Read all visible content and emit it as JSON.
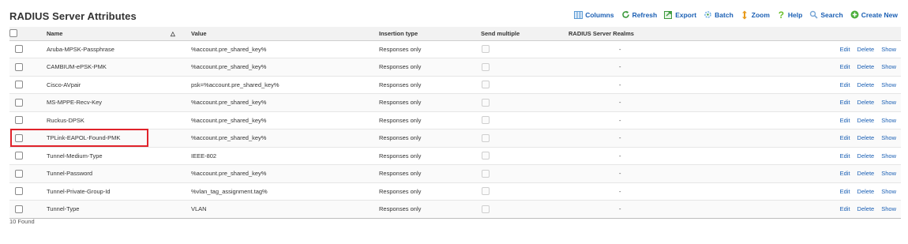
{
  "page": {
    "title": "RADIUS Server Attributes",
    "found_label": "10 Found"
  },
  "toolbar": {
    "items": [
      {
        "label": "Columns",
        "icon": "columns-icon",
        "color": "#5b9bd5"
      },
      {
        "label": "Refresh",
        "icon": "refresh-icon",
        "color": "#3c9a3c"
      },
      {
        "label": "Export",
        "icon": "export-icon",
        "color": "#3c9a3c"
      },
      {
        "label": "Batch",
        "icon": "batch-icon",
        "color": "#6fb0e8"
      },
      {
        "label": "Zoom",
        "icon": "zoom-icon",
        "color": "#e89a1a"
      },
      {
        "label": "Help",
        "icon": "help-icon",
        "color": "#6abf2a"
      },
      {
        "label": "Search",
        "icon": "search-icon",
        "color": "#7aa7d6"
      },
      {
        "label": "Create New",
        "icon": "create-new-icon",
        "color": "#4caf3c"
      }
    ]
  },
  "table": {
    "headers": {
      "name": "Name",
      "sort": "△",
      "value": "Value",
      "insertion_type": "Insertion type",
      "send_multiple": "Send multiple",
      "realms": "RADIUS Server Realms"
    },
    "actions": {
      "edit": "Edit",
      "delete": "Delete",
      "show": "Show"
    },
    "rows": [
      {
        "name": "Aruba-MPSK-Passphrase",
        "value": "%account.pre_shared_key%",
        "insertion_type": "Responses only",
        "realms": "-"
      },
      {
        "name": "CAMBIUM-ePSK-PMK",
        "value": "%account.pre_shared_key%",
        "insertion_type": "Responses only",
        "realms": "-"
      },
      {
        "name": "Cisco-AVpair",
        "value": "psk=%account.pre_shared_key%",
        "insertion_type": "Responses only",
        "realms": "-"
      },
      {
        "name": "MS-MPPE-Recv-Key",
        "value": "%account.pre_shared_key%",
        "insertion_type": "Responses only",
        "realms": "-"
      },
      {
        "name": "Ruckus-DPSK",
        "value": "%account.pre_shared_key%",
        "insertion_type": "Responses only",
        "realms": "-"
      },
      {
        "name": "TPLink-EAPOL-Found-PMK",
        "value": "%account.pre_shared_key%",
        "insertion_type": "Responses only",
        "realms": "-"
      },
      {
        "name": "Tunnel-Medium-Type",
        "value": "IEEE-802",
        "insertion_type": "Responses only",
        "realms": "-"
      },
      {
        "name": "Tunnel-Password",
        "value": "%account.pre_shared_key%",
        "insertion_type": "Responses only",
        "realms": "-"
      },
      {
        "name": "Tunnel-Private-Group-Id",
        "value": "%vlan_tag_assignment.tag%",
        "insertion_type": "Responses only",
        "realms": "-"
      },
      {
        "name": "Tunnel-Type",
        "value": "VLAN",
        "insertion_type": "Responses only",
        "realms": "-"
      }
    ]
  },
  "highlight": {
    "row_name": "TPLink-EAPOL-Found-PMK",
    "color": "#e0232b"
  },
  "colors": {
    "link": "#1a5fb4",
    "header_bg": "#f2f2f2"
  }
}
